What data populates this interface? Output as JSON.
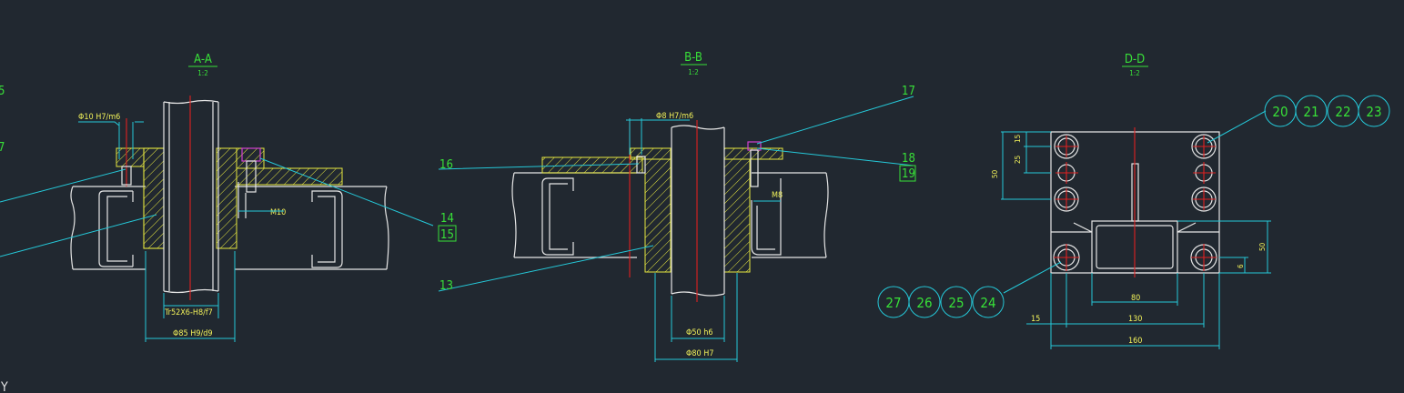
{
  "sections": {
    "aa": {
      "title": "A-A",
      "scale": "1:2"
    },
    "bb": {
      "title": "B-B",
      "scale": "1:2"
    },
    "dd": {
      "title": "D-D",
      "scale": "1:2"
    }
  },
  "aa_dims": {
    "top_fit": "Φ10 H7/m6",
    "thread": "Tr52X6-H8/f7",
    "bottom_fit": "Φ85 H9/d9",
    "bolt": "M10"
  },
  "aa_labels": {
    "left_a": "5",
    "left_b": "7",
    "right_a": "14",
    "right_b": "15"
  },
  "bb_dims": {
    "top_fit": "Φ8 H7/m6",
    "bolt": "M8",
    "shaft": "Φ50 h6",
    "bore": "Φ80 H7"
  },
  "bb_labels": {
    "l16": "16",
    "l13": "13",
    "l17": "17",
    "l18": "18",
    "l19": "19"
  },
  "dd_dims": {
    "d15_top": "15",
    "d25": "25",
    "d50_left": "50",
    "d50_right": "50",
    "d6": "6",
    "d80": "80",
    "d130": "130",
    "d160": "160",
    "d15_bottom": "15"
  },
  "balloons_top": [
    "20",
    "21",
    "22",
    "23"
  ],
  "balloons_bottom": [
    "27",
    "26",
    "25",
    "24"
  ],
  "ucs": "Y",
  "colors": {
    "background": "#212830",
    "text_green": "#38e038",
    "dim_yellow": "#f2f25a",
    "leader_cyan": "#25c8d8",
    "centerline_red": "#e02020",
    "hatch_yellow": "#e8e840",
    "outline_white": "#e6e6e6"
  }
}
